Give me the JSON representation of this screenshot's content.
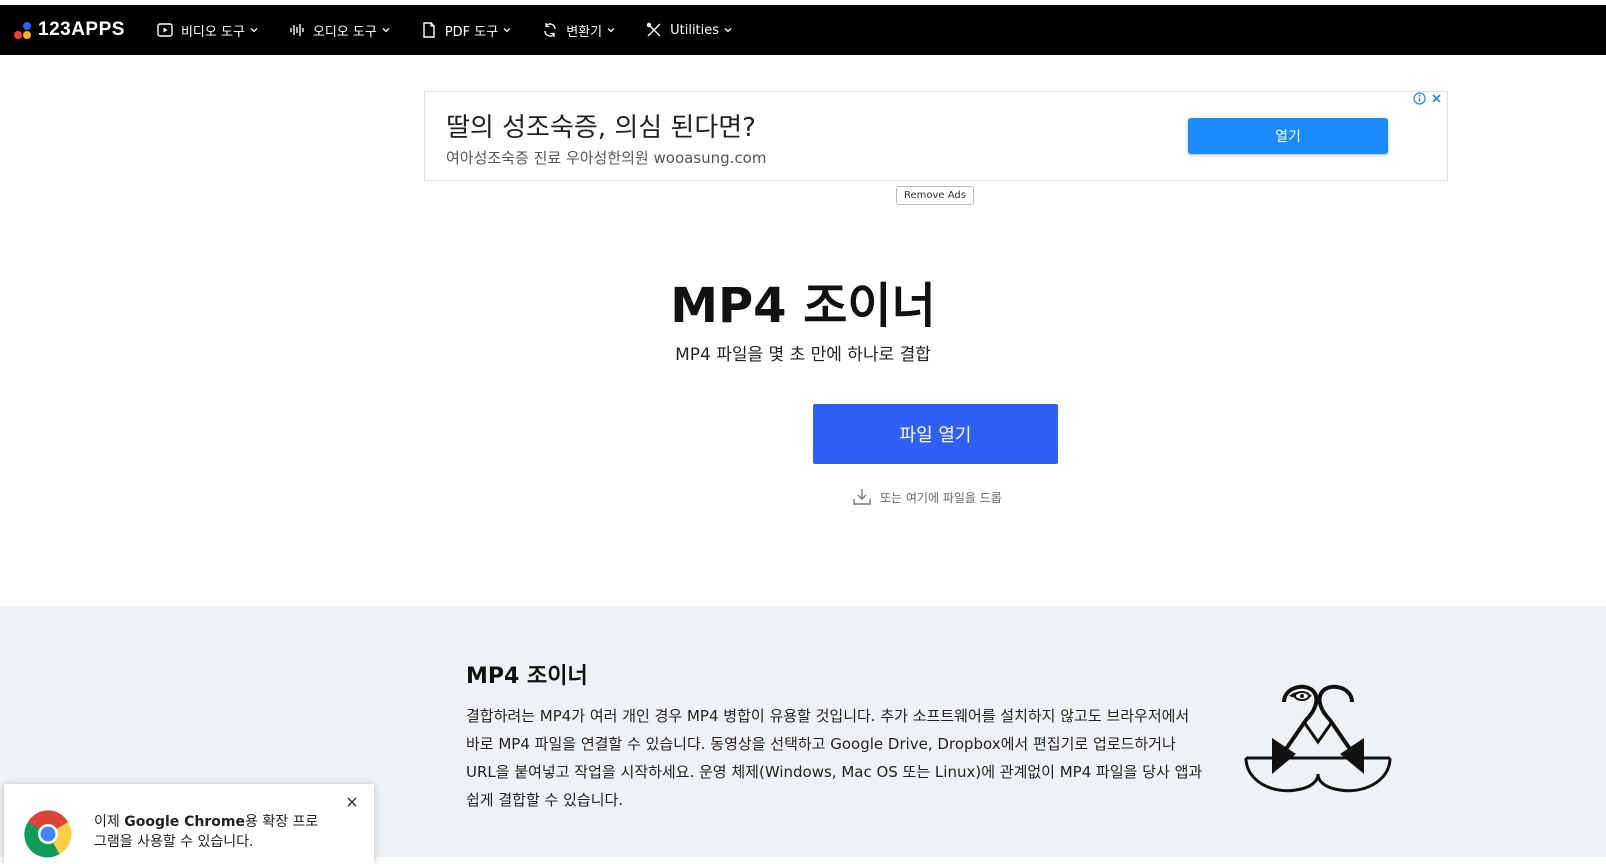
{
  "brand": {
    "name": "123APPS",
    "dot_colors": [
      "#ff3b3b",
      "#ffb300",
      "#2f5ff5"
    ]
  },
  "nav": [
    {
      "label": "비디오 도구",
      "icon": "play-icon"
    },
    {
      "label": "오디오 도구",
      "icon": "waveform-icon"
    },
    {
      "label": "PDF 도구",
      "icon": "document-icon"
    },
    {
      "label": "변환기",
      "icon": "convert-icon"
    },
    {
      "label": "Utilities",
      "icon": "tools-icon"
    }
  ],
  "ad": {
    "title": "딸의 성조숙증, 의심 된다면?",
    "subtitle": "여아성조숙증 진료 우아성한의원 wooasung.com",
    "button": "열기",
    "remove_ads": "Remove Ads"
  },
  "hero": {
    "title": "MP4 조이너",
    "subtitle": "MP4 파일을 몇 초 만에 하나로 결합",
    "open_button": "파일 열기",
    "drop_text": "또는 여기에 파일을 드롭"
  },
  "info": {
    "title": "MP4 조이너",
    "body": "결합하려는 MP4가 여러 개인 경우 MP4 병합이 유용할 것입니다. 추가 소프트웨어를 설치하지 않고도 브라우저에서 바로 MP4 파일을 연결할 수 있습니다. 동영상을 선택하고 Google Drive, Dropbox에서 편집기로 업로드하거나 URL을 붙여넣고 작업을 시작하세요. 운영 체제(Windows, Mac OS 또는 Linux)에 관계없이 MP4 파일을 당사 앱과 쉽게 결합할 수 있습니다."
  },
  "chrome_toast": {
    "text_before": "이제 ",
    "text_bold": "Google Chrome",
    "text_after": "용 확장 프로그램을 사용할 수 있습니다."
  },
  "colors": {
    "accent": "#2f5ff5",
    "ad_button": "#1a8cff",
    "nav_bg": "#000000",
    "info_bg": "#eff2f5"
  }
}
